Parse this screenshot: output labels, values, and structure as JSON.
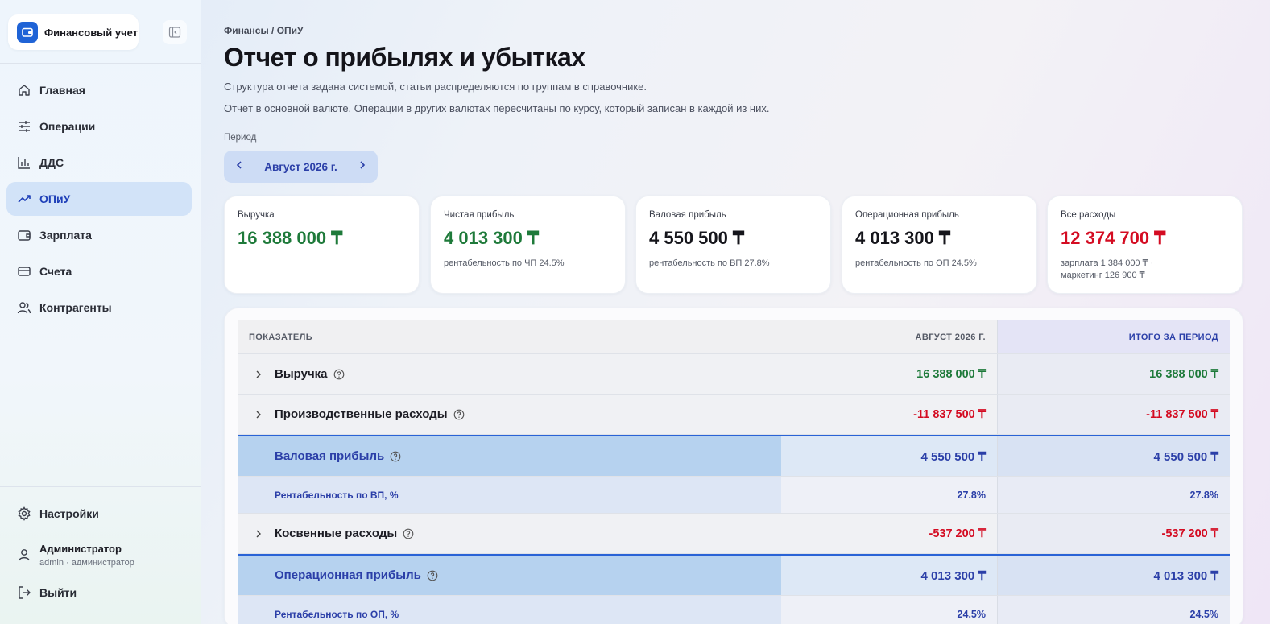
{
  "sidebar": {
    "brand": "Финансовый учет",
    "items": [
      {
        "label": "Главная",
        "icon": "home-icon"
      },
      {
        "label": "Операции",
        "icon": "sliders-icon"
      },
      {
        "label": "ДДС",
        "icon": "bar-chart-icon"
      },
      {
        "label": "ОПиУ",
        "icon": "trending-up-icon",
        "active": true
      },
      {
        "label": "Зарплата",
        "icon": "wallet-icon"
      },
      {
        "label": "Счета",
        "icon": "credit-card-icon"
      },
      {
        "label": "Контрагенты",
        "icon": "users-icon"
      }
    ],
    "settings": "Настройки",
    "user": {
      "name": "Администратор",
      "role": "admin · администратор"
    },
    "logout": "Выйти"
  },
  "main": {
    "breadcrumb": "Финансы / ОПиУ",
    "title": "Отчет о прибылях и убытках",
    "desc1": "Структура отчета задана системой, статьи распределяются по группам в справочнике.",
    "desc2": "Отчёт в основной валюте. Операции в других валютах пересчитаны по курсу, который записан в каждой из них.",
    "period_label": "Период",
    "period_value": "Август 2026 г."
  },
  "kpis": [
    {
      "label": "Выручка",
      "value": "16 388 000 ₸",
      "sub": "",
      "tone": "green"
    },
    {
      "label": "Чистая прибыль",
      "value": "4 013 300 ₸",
      "sub": "рентабельность по ЧП 24.5%",
      "tone": "green"
    },
    {
      "label": "Валовая прибыль",
      "value": "4 550 500 ₸",
      "sub": "рентабельность по ВП 27.8%",
      "tone": "dark"
    },
    {
      "label": "Операционная прибыль",
      "value": "4 013 300 ₸",
      "sub": "рентабельность по ОП 24.5%",
      "tone": "dark"
    },
    {
      "label": "Все расходы",
      "value": "12 374 700 ₸",
      "sub": "зарплата 1 384 000 ₸ · маркетинг 126 900 ₸",
      "tone": "red"
    }
  ],
  "table": {
    "headers": [
      "ПОКАЗАТЕЛЬ",
      "АВГУСТ 2026 Г.",
      "ИТОГО ЗА ПЕРИОД"
    ],
    "rows": [
      {
        "kind": "line",
        "label": "Выручка",
        "v1": "16 388 000 ₸",
        "v2": "16 388 000 ₸",
        "tone": "green"
      },
      {
        "kind": "line",
        "label": "Производственные расходы",
        "v1": "-11 837 500 ₸",
        "v2": "-11 837 500 ₸",
        "tone": "red"
      },
      {
        "kind": "sub",
        "label": "Валовая прибыль",
        "v1": "4 550 500 ₸",
        "v2": "4 550 500 ₸"
      },
      {
        "kind": "pct",
        "label": "Рентабельность по ВП, %",
        "v1": "27.8%",
        "v2": "27.8%"
      },
      {
        "kind": "line",
        "label": "Косвенные расходы",
        "v1": "-537 200 ₸",
        "v2": "-537 200 ₸",
        "tone": "red"
      },
      {
        "kind": "sub",
        "label": "Операционная прибыль",
        "v1": "4 013 300 ₸",
        "v2": "4 013 300 ₸"
      },
      {
        "kind": "pct",
        "label": "Рентабельность по ОП, %",
        "v1": "24.5%",
        "v2": "24.5%"
      }
    ]
  }
}
